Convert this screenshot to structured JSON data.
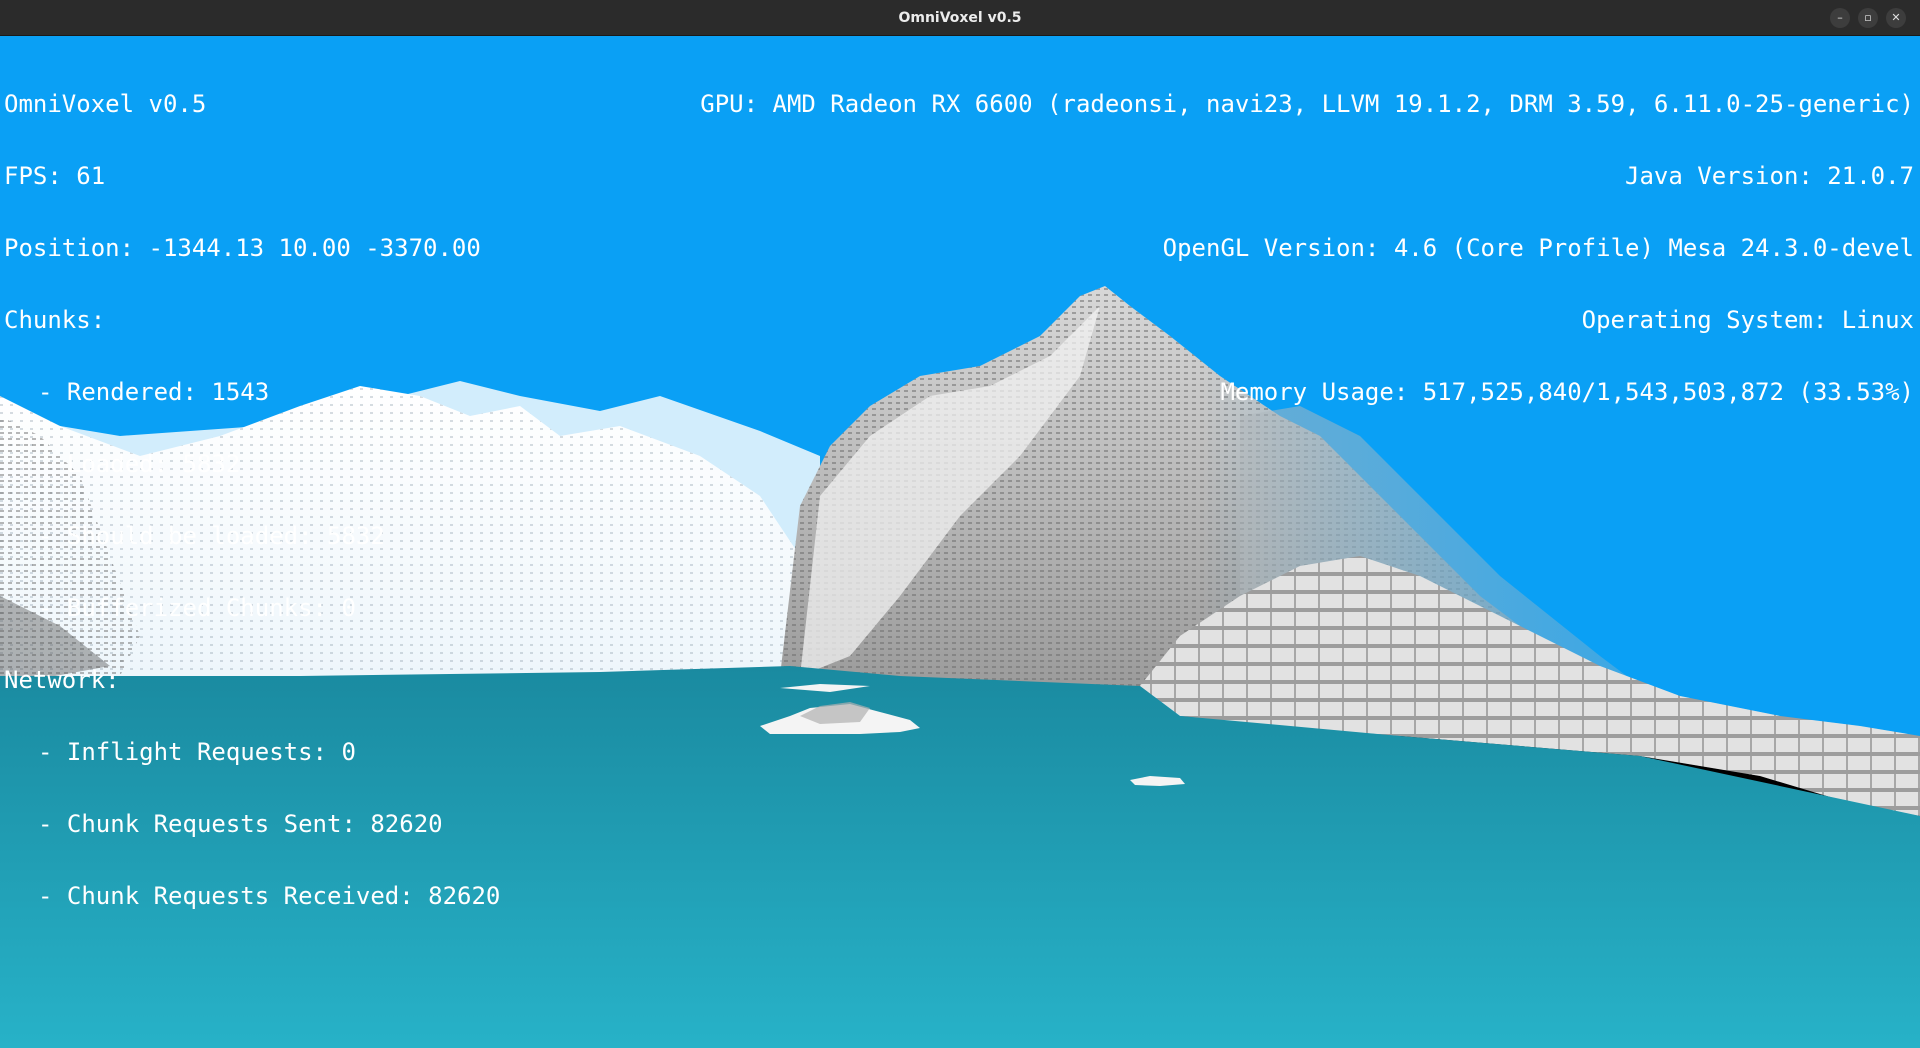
{
  "window": {
    "title": "OmniVoxel v0.5",
    "minimize_glyph": "–",
    "maximize_glyph": "▫",
    "close_glyph": "✕"
  },
  "hud_left": {
    "app_version": "OmniVoxel v0.5",
    "fps": "FPS: 61",
    "position": "Position: -1344.13 10.00 -3370.00",
    "chunks_header": "Chunks:",
    "chunks_rendered": "Rendered: 1543",
    "chunks_loaded": "Loaded: 5832",
    "chunks_should_be_loaded": "Should be loaded: 5832",
    "chunks_bufferized": "Bufferized Chunks: 0",
    "network_header": "Network:",
    "network_inflight": "Inflight Requests: 0",
    "network_sent": "Chunk Requests Sent: 82620",
    "network_received": "Chunk Requests Received: 82620"
  },
  "hud_right": {
    "gpu": "GPU: AMD Radeon RX 6600 (radeonsi, navi23, LLVM 19.1.2, DRM 3.59, 6.11.0-25-generic)",
    "java_version": "Java Version: 21.0.7",
    "opengl_version": "OpenGL Version: 4.6 (Core Profile) Mesa 24.3.0-devel",
    "operating_system": "Operating System: Linux",
    "memory_usage": "Memory Usage: 517,525,840/1,543,503,872 (33.53%)"
  },
  "colors": {
    "sky": "#0aa0f5",
    "water_far": "#1a8aa0",
    "water_near": "#25aac0",
    "snow": "#f4f8fb",
    "rock_grey": "#a6a6a6"
  }
}
